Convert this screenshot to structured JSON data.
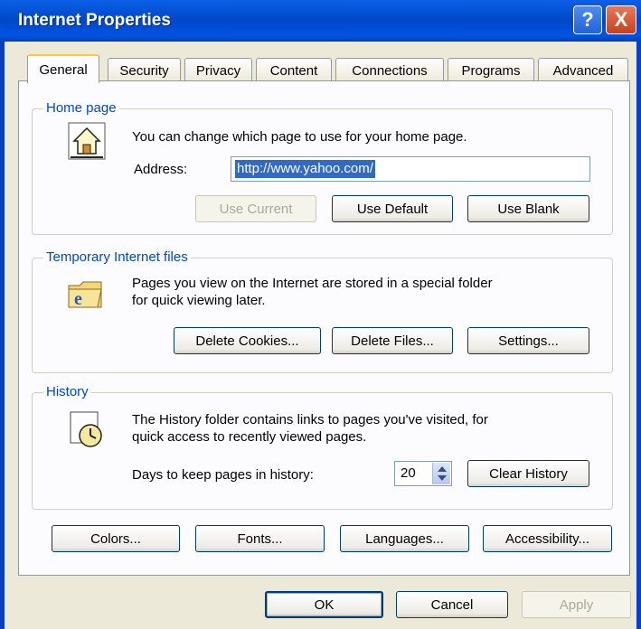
{
  "window": {
    "title": "Internet Properties"
  },
  "title_buttons": {
    "help": "?",
    "close": "X"
  },
  "tabs": [
    "General",
    "Security",
    "Privacy",
    "Content",
    "Connections",
    "Programs",
    "Advanced"
  ],
  "home_page": {
    "label": "Home page",
    "description": "You can change which page to use for your home page.",
    "address_label": "Address:",
    "address_value": "http://www.yahoo.com/",
    "use_current": "Use Current",
    "use_default": "Use Default",
    "use_blank": "Use Blank"
  },
  "temp_files": {
    "label": "Temporary Internet files",
    "description_line1": "Pages you view on the Internet are stored in a special folder",
    "description_line2": "for quick viewing later.",
    "delete_cookies": "Delete Cookies...",
    "delete_files": "Delete Files...",
    "settings": "Settings..."
  },
  "history": {
    "label": "History",
    "description_line1": "The History folder contains links to pages you've visited, for",
    "description_line2": "quick access to recently viewed pages.",
    "days_label": "Days to keep pages in history:",
    "days_value": "20",
    "clear_history": "Clear History"
  },
  "bottom_buttons": {
    "colors": "Colors...",
    "fonts": "Fonts...",
    "languages": "Languages...",
    "accessibility": "Accessibility..."
  },
  "dialog_buttons": {
    "ok": "OK",
    "cancel": "Cancel",
    "apply": "Apply"
  },
  "colors": {
    "titlebar": "#0054e3",
    "group_label": "#0046d5",
    "selection": "#316ac5",
    "dialog_bg": "#ece9d8"
  }
}
